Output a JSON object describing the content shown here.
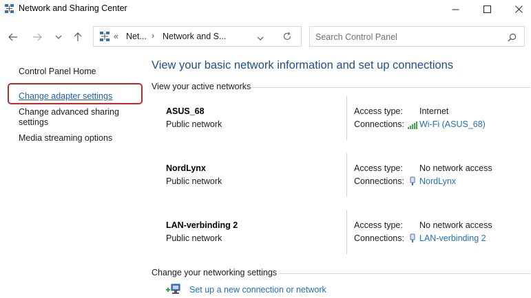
{
  "window": {
    "title": "Network and Sharing Center"
  },
  "address": {
    "overflow": "«",
    "crumb1": "Net...",
    "sep": "›",
    "crumb2": "Network and S...",
    "sep0": "›"
  },
  "search": {
    "placeholder": "Search Control Panel"
  },
  "sidebar": {
    "home": "Control Panel Home",
    "adapter": "Change adapter settings",
    "advanced_line1": "Change advanced sharing",
    "advanced_line2": "settings",
    "media": "Media streaming options"
  },
  "main": {
    "heading": "View your basic network information and set up connections",
    "active_label": "View your active networks",
    "networks": [
      {
        "name": "ASUS_68",
        "type": "Public network",
        "access_label": "Access type:",
        "access": "Internet",
        "conn_label": "Connections:",
        "conn": "Wi-Fi (ASUS_68)"
      },
      {
        "name": "NordLynx",
        "type": "Public network",
        "access_label": "Access type:",
        "access": "No network access",
        "conn_label": "Connections:",
        "conn": "NordLynx"
      },
      {
        "name": "LAN-verbinding 2",
        "type": "Public network",
        "access_label": "Access type:",
        "access": "No network access",
        "conn_label": "Connections:",
        "conn": "LAN-verbinding 2"
      }
    ],
    "change_label": "Change your networking settings",
    "setup_link": "Set up a new connection or network"
  },
  "colors": {
    "link": "#1f6fbf",
    "heading": "#1f4e8c",
    "highlight": "#c62828"
  }
}
